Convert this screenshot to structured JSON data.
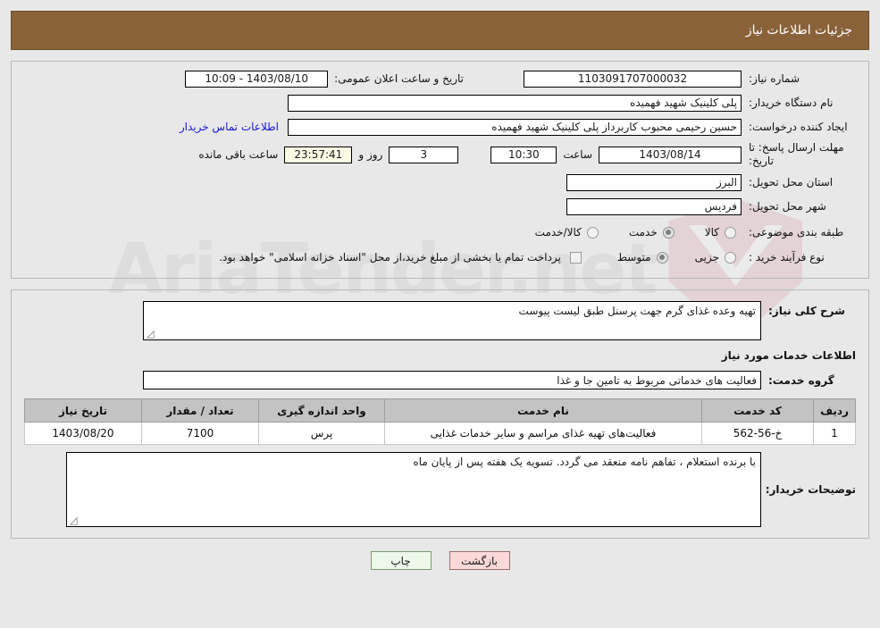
{
  "header": {
    "title": "جزئیات اطلاعات نیاز",
    "bg": "#8a6239"
  },
  "form": {
    "need_number_label": "شماره نیاز:",
    "need_number_value": "1103091707000032",
    "announce_label": "تاریخ و ساعت اعلان عمومی:",
    "announce_value": "1403/08/10 - 10:09",
    "buyer_org_label": "نام دستگاه خریدار:",
    "buyer_org_value": "پلی کلینیک شهید فهمیده",
    "creator_label": "ایجاد کننده درخواست:",
    "creator_value": "حسین رحیمی محبوب کاربرداز پلی کلینیک شهید فهمیده",
    "contact_link": "اطلاعات تماس خریدار",
    "deadline_label": "مهلت ارسال پاسخ: تا تاریخ:",
    "deadline_date": "1403/08/14",
    "hour_label": "ساعت",
    "deadline_time": "10:30",
    "days_value": "3",
    "days_label": "روز و",
    "remaining_time": "23:57:41",
    "remaining_label": "ساعت باقی مانده",
    "province_label": "استان محل تحویل:",
    "province_value": "البرز",
    "city_label": "شهر محل تحویل:",
    "city_value": "فردیس",
    "category_label": "طبقه بندی موضوعی:",
    "category_options": [
      {
        "label": "کالا",
        "selected": false
      },
      {
        "label": "خدمت",
        "selected": true
      },
      {
        "label": "کالا/خدمت",
        "selected": false
      }
    ],
    "process_label": "نوع فرآیند خرید :",
    "process_options": [
      {
        "label": "جزیی",
        "selected": false
      },
      {
        "label": "متوسط",
        "selected": true
      }
    ],
    "treasury_checkbox_label": "پرداخت تمام یا بخشی از مبلغ خرید،از محل \"اسناد خزانه اسلامی\" خواهد بود.",
    "treasury_checked": false
  },
  "need_desc": {
    "label": "شرح کلی نیاز:",
    "value": "تهیه وعده غذای گرم جهت پرسنل طبق لیست پیوست"
  },
  "services": {
    "heading": "اطلاعات خدمات مورد نیاز",
    "group_label": "گروه خدمت:",
    "group_value": "فعالیت های خدماتی مربوط به تامین جا و غذا",
    "columns": [
      "ردیف",
      "کد خدمت",
      "نام خدمت",
      "واحد اندازه گیری",
      "تعداد / مقدار",
      "تاریخ نیاز"
    ],
    "rows": [
      {
        "row_no": "1",
        "service_code": "خ-56-562",
        "service_name": "فعالیت‌های تهیه غذای مراسم و سایر خدمات غذایی",
        "unit": "پرس",
        "quantity": "7100",
        "need_date": "1403/08/20"
      }
    ]
  },
  "buyer_notes": {
    "label": "توضیحات خریدار:",
    "value": "با برنده استعلام ، تفاهم نامه منعقد می گردد. تسویه یک هفته پس از پایان ماه"
  },
  "buttons": {
    "print": "چاپ",
    "back": "بازگشت"
  },
  "watermark": {
    "text": "AriaTender.net"
  }
}
